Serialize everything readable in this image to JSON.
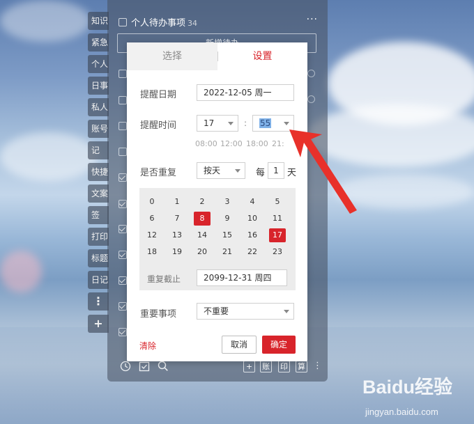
{
  "left_tabs": [
    "知识",
    "紧急",
    "个人",
    "日事",
    "私人",
    "账号",
    "记",
    "快捷",
    "文案",
    "签",
    "打印",
    "标题",
    "日记"
  ],
  "left_tab_icons": {
    "more": "⋮",
    "add": "+"
  },
  "panel": {
    "title": "个人待办事项",
    "count": "34",
    "input_placeholder": "新增待办",
    "more_icon": "···"
  },
  "dialog": {
    "tabs": {
      "select": "选择",
      "settings": "设置"
    },
    "remind_date": {
      "label": "提醒日期",
      "value": "2022-12-05 周一"
    },
    "remind_time": {
      "label": "提醒时间",
      "hour": "17",
      "separator": ":",
      "minute": "55",
      "quick_times": [
        "08:00",
        "12:00",
        "18:00",
        "21:"
      ]
    },
    "repeat": {
      "label": "是否重复",
      "mode": "按天",
      "every_label": "每",
      "interval": "1",
      "unit": "天"
    },
    "hours": [
      "0",
      "1",
      "2",
      "3",
      "4",
      "5",
      "6",
      "7",
      "8",
      "9",
      "10",
      "11",
      "12",
      "13",
      "14",
      "15",
      "16",
      "17",
      "18",
      "19",
      "20",
      "21",
      "22",
      "23"
    ],
    "selected_hours": [
      "8",
      "17"
    ],
    "repeat_until": {
      "label": "重复截止",
      "value": "2099-12-31 周四"
    },
    "importance": {
      "label": "重要事项",
      "value": "不重要"
    },
    "clear_label": "清除",
    "cancel_label": "取消",
    "confirm_label": "确定"
  },
  "bottom_bar": {
    "boxes": [
      "+",
      "账",
      "印",
      "算"
    ]
  },
  "watermark": {
    "brand": "Baidu经验",
    "url": "jingyan.baidu.com"
  },
  "colors": {
    "accent": "#d8242b",
    "selection": "#7fb1e8",
    "annotation_arrow": "#e8312a"
  }
}
